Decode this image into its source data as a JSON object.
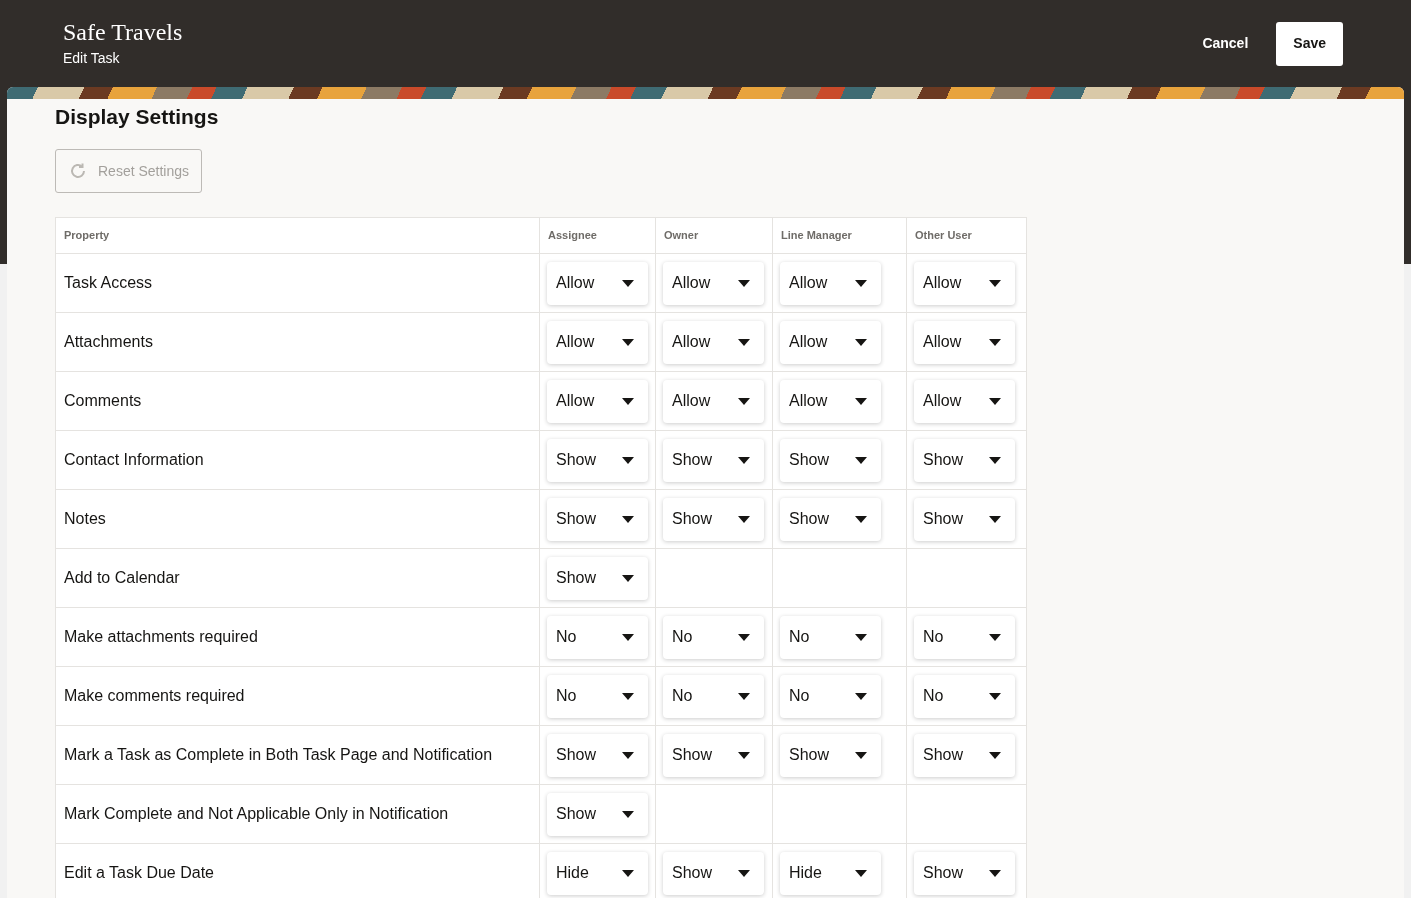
{
  "header": {
    "title": "Safe Travels",
    "subtitle": "Edit Task",
    "actions": [
      {
        "label": "Cancel",
        "kind": "text"
      },
      {
        "label": "Save",
        "kind": "primary"
      }
    ]
  },
  "section": {
    "title": "Display Settings",
    "reset_button": {
      "label": "Reset Settings",
      "disabled": true
    }
  },
  "table": {
    "columns": [
      "Property",
      "Assignee",
      "Owner",
      "Line Manager",
      "Other User"
    ],
    "rows": [
      {
        "property": "Task Access",
        "assignee": "Allow",
        "owner": "Allow",
        "line_manager": "Allow",
        "other_user": "Allow"
      },
      {
        "property": "Attachments",
        "assignee": "Allow",
        "owner": "Allow",
        "line_manager": "Allow",
        "other_user": "Allow"
      },
      {
        "property": "Comments",
        "assignee": "Allow",
        "owner": "Allow",
        "line_manager": "Allow",
        "other_user": "Allow"
      },
      {
        "property": "Contact Information",
        "assignee": "Show",
        "owner": "Show",
        "line_manager": "Show",
        "other_user": "Show"
      },
      {
        "property": "Notes",
        "assignee": "Show",
        "owner": "Show",
        "line_manager": "Show",
        "other_user": "Show"
      },
      {
        "property": "Add to Calendar",
        "assignee": "Show"
      },
      {
        "property": "Make attachments required",
        "assignee": "No",
        "owner": "No",
        "line_manager": "No",
        "other_user": "No"
      },
      {
        "property": "Make comments required",
        "assignee": "No",
        "owner": "No",
        "line_manager": "No",
        "other_user": "No"
      },
      {
        "property": "Mark a Task as Complete in Both Task Page and Notification",
        "assignee": "Show",
        "owner": "Show",
        "line_manager": "Show",
        "other_user": "Show"
      },
      {
        "property": "Mark Complete and Not Applicable Only in Notification",
        "assignee": "Show"
      },
      {
        "property": "Edit a Task Due Date",
        "assignee": "Hide",
        "owner": "Show",
        "line_manager": "Hide",
        "other_user": "Show"
      }
    ]
  }
}
